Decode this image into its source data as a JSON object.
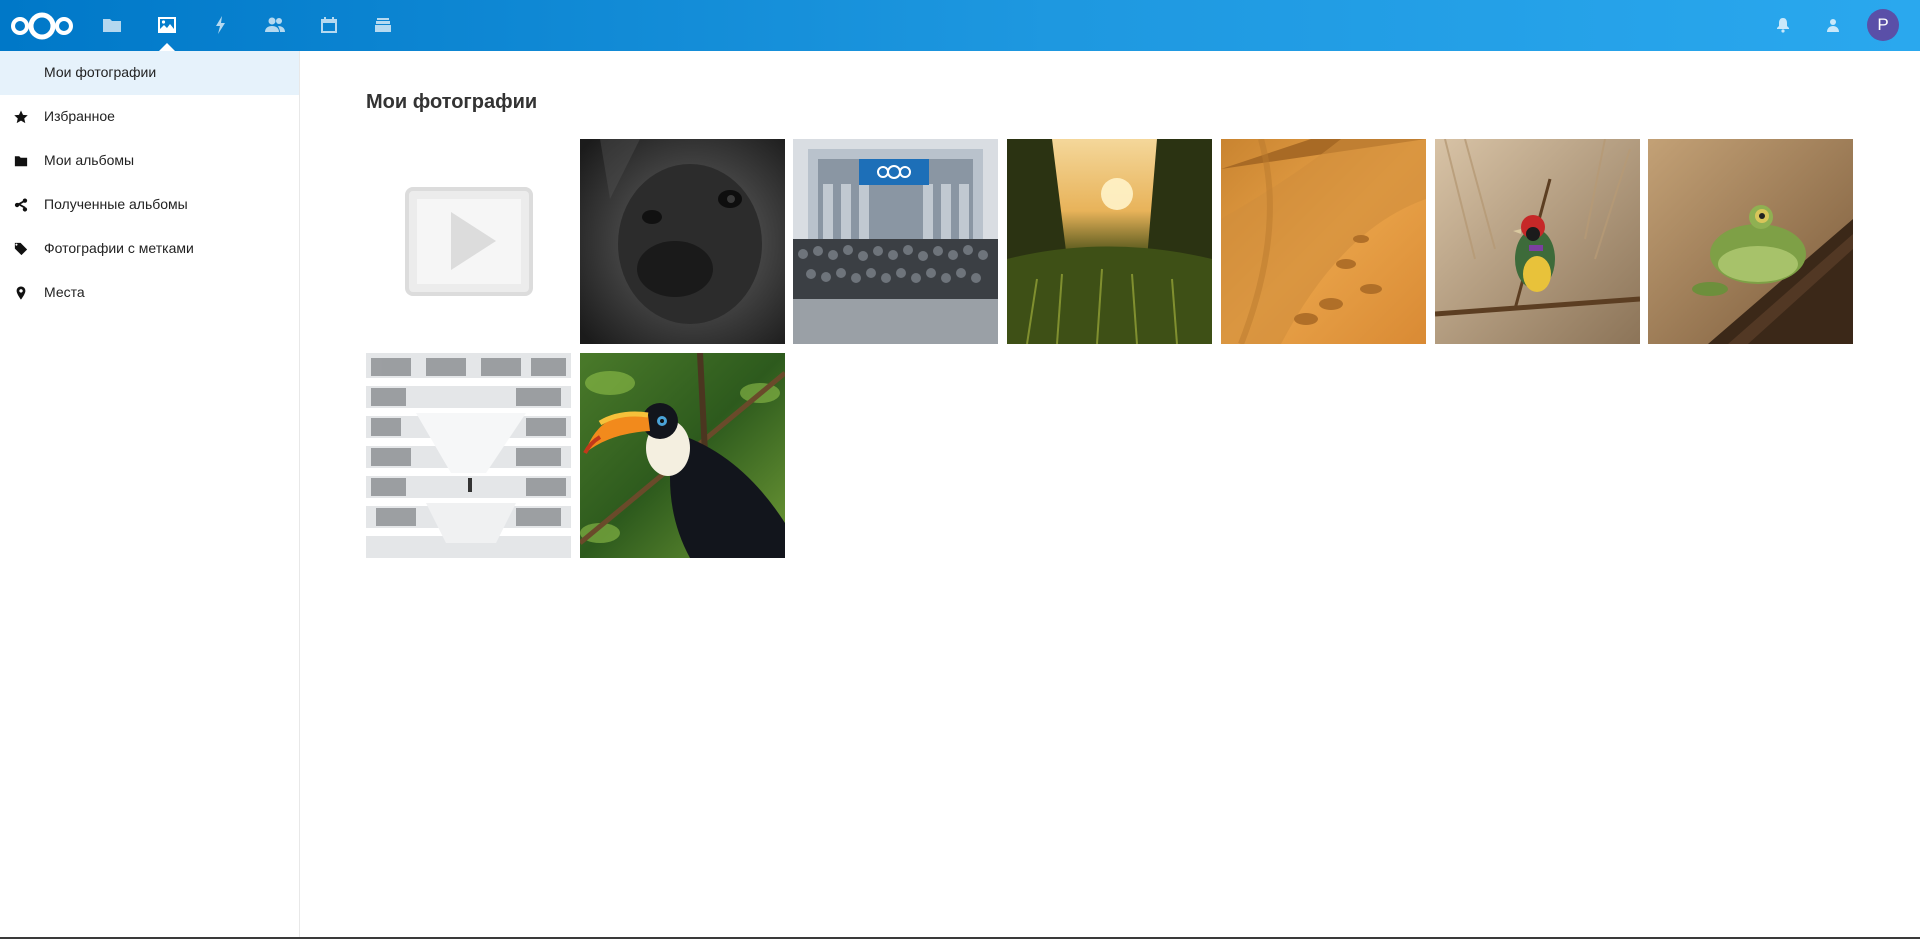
{
  "header": {
    "apps": [
      {
        "name": "files",
        "icon": "folder-icon"
      },
      {
        "name": "photos",
        "icon": "image-icon",
        "active": true
      },
      {
        "name": "activity",
        "icon": "lightning-icon"
      },
      {
        "name": "contacts",
        "icon": "contacts-icon"
      },
      {
        "name": "calendar",
        "icon": "calendar-icon"
      },
      {
        "name": "deck",
        "icon": "stack-icon"
      }
    ],
    "right": {
      "notifications_icon": "bell-icon",
      "contacts_menu_icon": "contacts-menu-icon",
      "avatar_letter": "P"
    },
    "colors": {
      "header_start": "#0078c8",
      "header_end": "#2aa8ee",
      "avatar": "#5a4fa8"
    }
  },
  "sidebar": {
    "items": [
      {
        "label": "Мои фотографии",
        "icon": null,
        "active": true
      },
      {
        "label": "Избранное",
        "icon": "star-icon"
      },
      {
        "label": "Мои альбомы",
        "icon": "folder-icon"
      },
      {
        "label": "Полученные альбомы",
        "icon": "share-icon"
      },
      {
        "label": "Фотографии с метками",
        "icon": "tag-icon"
      },
      {
        "label": "Места",
        "icon": "location-pin-icon"
      }
    ],
    "active_color": "#e6f2fb"
  },
  "main": {
    "title": "Мои фотографии",
    "tiles": [
      {
        "kind": "video-placeholder",
        "subject": "video"
      },
      {
        "kind": "photo",
        "subject": "gorilla"
      },
      {
        "kind": "photo",
        "subject": "group-photo-building"
      },
      {
        "kind": "photo",
        "subject": "sunset-field"
      },
      {
        "kind": "photo",
        "subject": "desert-dunes"
      },
      {
        "kind": "photo",
        "subject": "finch-bird"
      },
      {
        "kind": "photo",
        "subject": "frog"
      },
      {
        "kind": "photo",
        "subject": "library-interior"
      },
      {
        "kind": "photo",
        "subject": "toucan"
      }
    ]
  }
}
